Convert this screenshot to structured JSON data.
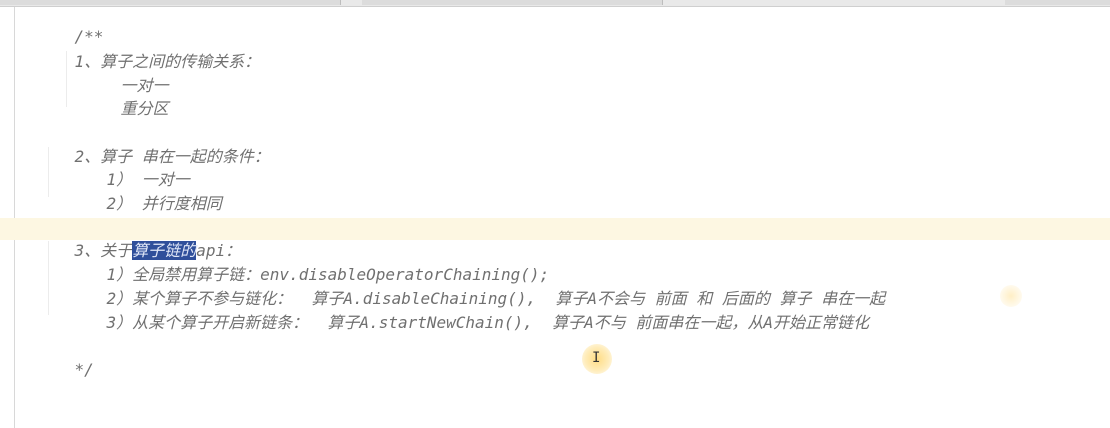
{
  "editor": {
    "lines": [
      {
        "id": "l0",
        "text": "/**"
      },
      {
        "id": "l1",
        "text": "1、算子之间的传输关系："
      },
      {
        "id": "l2",
        "text": "一对一"
      },
      {
        "id": "l3",
        "text": "重分区"
      },
      {
        "id": "l4",
        "text": "2、算子 串在一起的条件："
      },
      {
        "id": "l5",
        "text": "1） 一对一"
      },
      {
        "id": "l6",
        "text": "2） 并行度相同"
      },
      {
        "id": "l7_pre",
        "text": "3、关于"
      },
      {
        "id": "l7_sel",
        "text": "算子链的"
      },
      {
        "id": "l7_post",
        "text": "api："
      },
      {
        "id": "l8",
        "text": "1）全局禁用算子链：env.disableOperatorChaining();"
      },
      {
        "id": "l9",
        "text": "2）某个算子不参与链化：  算子A.disableChaining(),  算子A不会与 前面 和 后面的 算子 串在一起"
      },
      {
        "id": "l10",
        "text": "3）从某个算子开启新链条：  算子A.startNewChain(),  算子A不与 前面串在一起，从A开始正常链化"
      },
      {
        "id": "l11",
        "text": "*/"
      }
    ],
    "cursor_glyph": "I"
  },
  "colors": {
    "comment": "#707070",
    "selection": "#2f4f9b",
    "current_line": "#fdf7e2",
    "background": "#ffffff"
  }
}
